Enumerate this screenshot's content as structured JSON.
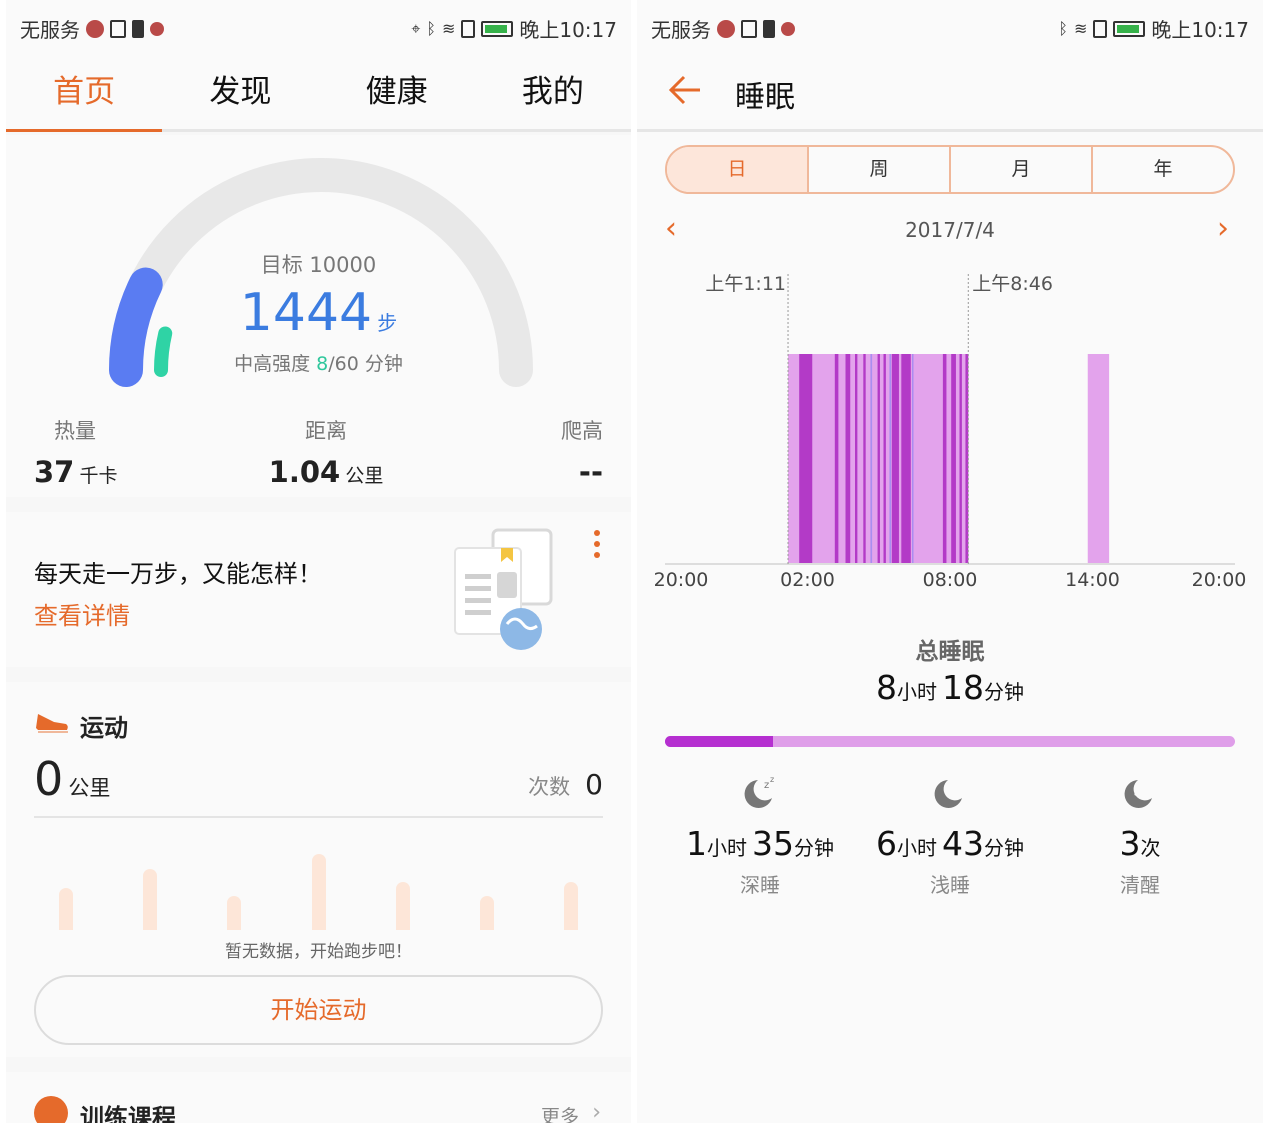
{
  "status_bar": {
    "carrier": "无服务",
    "time": "晚上10:17"
  },
  "left": {
    "tabs": [
      {
        "label": "首页",
        "active": true
      },
      {
        "label": "发现",
        "active": false
      },
      {
        "label": "健康",
        "active": false
      },
      {
        "label": "我的",
        "active": false
      }
    ],
    "steps": {
      "goal_text": "目标 10000",
      "count": "1444",
      "unit": "步",
      "intensity_prefix": "中高强度 ",
      "intensity_done": "8",
      "intensity_suffix": "/60 分钟",
      "progress_fraction": 0.1444
    },
    "metrics": [
      {
        "label": "热量",
        "value": "37",
        "unit": "千卡"
      },
      {
        "label": "距离",
        "value": "1.04",
        "unit": "公里"
      },
      {
        "label": "爬高",
        "value": "--",
        "unit": ""
      }
    ],
    "article": {
      "title": "每天走一万步，又能怎样！",
      "link": "查看详情"
    },
    "exercise": {
      "title": "运动",
      "distance_value": "0",
      "distance_unit": "公里",
      "count_label": "次数",
      "count_value": "0",
      "placeholder_bars": [
        0.55,
        0.8,
        0.45,
        1.0,
        0.63,
        0.45,
        0.63
      ],
      "empty_text": "暂无数据，开始跑步吧！",
      "start_button": "开始运动"
    },
    "training": {
      "title": "训练课程",
      "more": "更多"
    }
  },
  "right": {
    "title": "睡眠",
    "segments": [
      {
        "label": "日",
        "active": true
      },
      {
        "label": "周",
        "active": false
      },
      {
        "label": "月",
        "active": false
      },
      {
        "label": "年",
        "active": false
      }
    ],
    "date": "2017/7/4",
    "chart_data": {
      "type": "bar",
      "x_ticks": [
        "20:00",
        "02:00",
        "08:00",
        "14:00",
        "20:00"
      ],
      "x_range_hours": [
        20,
        44
      ],
      "markers": [
        {
          "label": "上午1:11",
          "hour": 25.18
        },
        {
          "label": "上午8:46",
          "hour": 32.77
        }
      ],
      "segments": [
        {
          "start": 25.18,
          "end": 32.77,
          "stage": "light"
        },
        {
          "start": 25.65,
          "end": 26.2,
          "stage": "deep"
        },
        {
          "start": 27.15,
          "end": 27.3,
          "stage": "deep"
        },
        {
          "start": 27.6,
          "end": 27.8,
          "stage": "deep"
        },
        {
          "start": 28.0,
          "end": 28.1,
          "stage": "deep"
        },
        {
          "start": 28.35,
          "end": 28.45,
          "stage": "deep"
        },
        {
          "start": 28.95,
          "end": 29.05,
          "stage": "deep"
        },
        {
          "start": 29.2,
          "end": 29.3,
          "stage": "deep"
        },
        {
          "start": 29.55,
          "end": 29.85,
          "stage": "deep"
        },
        {
          "start": 29.95,
          "end": 30.35,
          "stage": "deep"
        },
        {
          "start": 31.7,
          "end": 31.85,
          "stage": "deep"
        },
        {
          "start": 32.05,
          "end": 32.25,
          "stage": "deep"
        },
        {
          "start": 32.4,
          "end": 32.5,
          "stage": "deep"
        },
        {
          "start": 32.65,
          "end": 32.77,
          "stage": "deep"
        },
        {
          "start": 28.65,
          "end": 28.72,
          "stage": "awake"
        },
        {
          "start": 29.45,
          "end": 29.52,
          "stage": "awake"
        },
        {
          "start": 30.4,
          "end": 30.45,
          "stage": "awake"
        },
        {
          "start": 37.8,
          "end": 38.7,
          "stage": "light"
        }
      ],
      "colors": {
        "light": "#e3a3ec",
        "deep": "#b33ac7",
        "awake": "#a98ef0"
      }
    },
    "total": {
      "label": "总睡眠",
      "hours": "8",
      "hours_unit": "小时",
      "minutes": "18",
      "minutes_unit": "分钟"
    },
    "ratio_deep": 0.19,
    "stats": [
      {
        "h": "1",
        "hu": "小时",
        "m": "35",
        "mu": "分钟",
        "label": "深睡",
        "icon": "moon-zzz-icon"
      },
      {
        "h": "6",
        "hu": "小时",
        "m": "43",
        "mu": "分钟",
        "label": "浅睡",
        "icon": "moon-icon"
      },
      {
        "h": "3",
        "hu": "次",
        "m": "",
        "mu": "",
        "label": "清醒",
        "icon": "moon-awake-icon"
      }
    ]
  }
}
